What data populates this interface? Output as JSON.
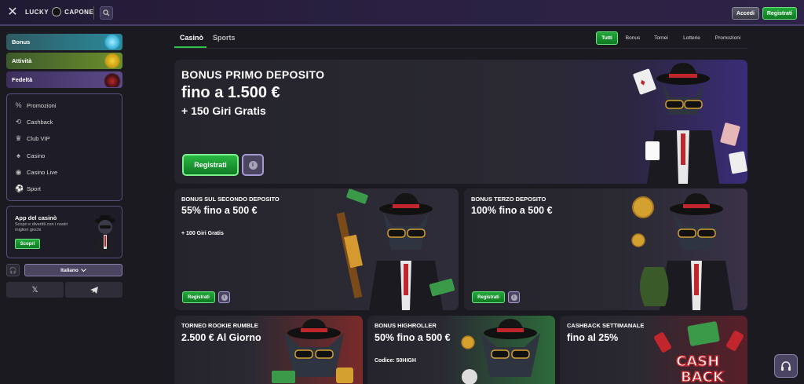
{
  "header": {
    "logo_left": "LUCKY",
    "logo_right": "CAPONE",
    "login_label": "Accedi",
    "register_label": "Registrati"
  },
  "sidebar": {
    "promo_tabs": [
      {
        "label": "Bonus"
      },
      {
        "label": "Attività"
      },
      {
        "label": "Fedeltà"
      }
    ],
    "nav_items": [
      {
        "label": "Promozioni",
        "icon": "tag-icon"
      },
      {
        "label": "Cashback",
        "icon": "cashback-icon"
      },
      {
        "label": "Club VIP",
        "icon": "crown-icon"
      },
      {
        "label": "Casino",
        "icon": "cards-icon"
      },
      {
        "label": "Casino Live",
        "icon": "live-icon"
      },
      {
        "label": "Sport",
        "icon": "ball-icon"
      }
    ],
    "app": {
      "title": "App del casinò",
      "subtitle": "Scopri e divertiti con i nostri migliori giochi",
      "button": "Scopri"
    },
    "language": "Italiano"
  },
  "main_tabs": [
    {
      "label": "Casinò",
      "active": true
    },
    {
      "label": "Sports",
      "active": false
    }
  ],
  "filters": [
    {
      "label": "Tutti",
      "active": true
    },
    {
      "label": "Bonus",
      "active": false
    },
    {
      "label": "Tornei",
      "active": false
    },
    {
      "label": "Lotterie",
      "active": false
    },
    {
      "label": "Promozioni",
      "active": false
    }
  ],
  "hero": {
    "kicker": "BONUS PRIMO DEPOSITO",
    "line1": "fino a 1.500 €",
    "line2": "+ 150 Giri Gratis",
    "button": "Registrati",
    "info": "i"
  },
  "cards_mid": [
    {
      "kicker": "BONUS SUL SECONDO DEPOSITO",
      "big": "55% fino a 500 €",
      "small": "+ 100 Giri Gratis",
      "button": "Registrati",
      "info": "i"
    },
    {
      "kicker": "BONUS TERZO DEPOSITO",
      "big": "100% fino a 500 €",
      "small": "",
      "button": "Registrati",
      "info": "i"
    }
  ],
  "cards_bottom": [
    {
      "kicker": "TORNEO ROOKIE RUMBLE",
      "big": "2.500 € Al Giorno",
      "small": ""
    },
    {
      "kicker": "BONUS HIGHROLLER",
      "big": "50% fino a 500 €",
      "small": "Codice: 50HIGH"
    },
    {
      "kicker": "CASHBACK SETTIMANALE",
      "big": "fino al 25%",
      "small": ""
    }
  ],
  "art_text": {
    "cashback_line1": "CASH",
    "cashback_line2": "BACK"
  },
  "colors": {
    "accent_green": "#22a83a",
    "header_bg": "#2a2142",
    "page_bg": "#1a1a20",
    "border_purple": "#5b4f7d"
  }
}
